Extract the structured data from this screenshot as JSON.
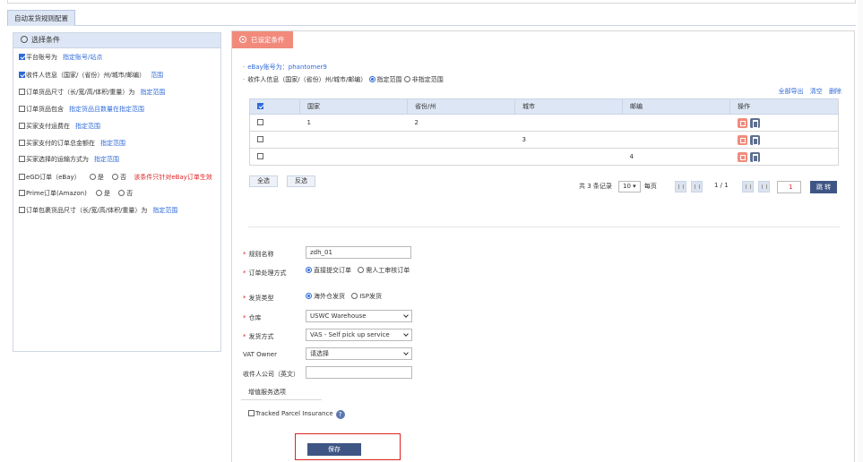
{
  "tab": {
    "title": "自动发货规则配置"
  },
  "conditions": {
    "header": "选择条件",
    "items": [
      {
        "label": "平台账号为",
        "checked": true,
        "link": "指定账号/站点"
      },
      {
        "label": "收件人信息（国家/（省份）州/城市/邮编）",
        "checked": true,
        "link": "范围"
      },
      {
        "label": "订单货品尺寸（长/宽/高/体积/重量）为",
        "checked": false,
        "link": "指定范围"
      },
      {
        "label": "订单货品包含",
        "checked": false,
        "link": "指定货品且数量在指定范围"
      },
      {
        "label": "买家支付运费在",
        "checked": false,
        "link": "指定范围"
      },
      {
        "label": "买家支付的订单总金额在",
        "checked": false,
        "link": "指定范围"
      },
      {
        "label": "买家选择的运输方式为",
        "checked": false,
        "link": "指定范围"
      },
      {
        "label": "eGD订单（eBay）",
        "checked": false,
        "opt_yes": "是",
        "opt_no": "否",
        "note": "该条件只针对eBay订单生效"
      },
      {
        "label": "Prime订单(Amazon)",
        "checked": false,
        "opt_yes": "是",
        "opt_no": "否"
      },
      {
        "label": "订单包裹货品尺寸（长/宽/高/体积/重量）为",
        "checked": false,
        "link": "指定范围"
      }
    ]
  },
  "settings": {
    "tab_label": "已设定条件",
    "ebay_account": "eBay账号为：phantomer9",
    "recipient_label": "收件人信息（国家/（省份）州/城市/邮编）",
    "range_specified": "指定范围",
    "range_unspecified": "非指定范围",
    "actions": {
      "export_all": "全部导出",
      "clear": "清空",
      "delete": "删除"
    },
    "table": {
      "headers": [
        "国家",
        "省份/州",
        "城市",
        "邮编",
        "操作"
      ],
      "rows": [
        {
          "country": "1",
          "province": "2",
          "city": "",
          "zip": ""
        },
        {
          "country": "",
          "province": "",
          "city": "3",
          "zip": ""
        },
        {
          "country": "",
          "province": "",
          "city": "",
          "zip": "4"
        }
      ]
    },
    "select_all": "全选",
    "invert": "反选",
    "pager": {
      "total": "共 3 条记录",
      "per_page_value": "10",
      "per_page_label": "每页",
      "page_info": "1 / 1",
      "page_input": "1",
      "jump": "跳 转"
    }
  },
  "form": {
    "rule_name_label": "规则名称",
    "rule_name_value": "zdh_01",
    "processing_label": "订单处理方式",
    "processing_opt1": "直接提交订单",
    "processing_opt2": "需人工审核订单",
    "ship_type_label": "发货类型",
    "ship_type_opt1": "海外仓发货",
    "ship_type_opt2": "ISP发货",
    "warehouse_label": "仓库",
    "warehouse_value": "USWC Warehouse",
    "ship_method_label": "发货方式",
    "ship_method_value": "VAS - Self pick up service",
    "vat_label": "VAT Owner",
    "vat_value": "请选择",
    "company_label": "收件人公司（英文）",
    "company_value": "",
    "vas_header": "增值服务选项",
    "tracked_label": "Tracked Parcel Insurance",
    "help": "?",
    "save": "保存"
  }
}
